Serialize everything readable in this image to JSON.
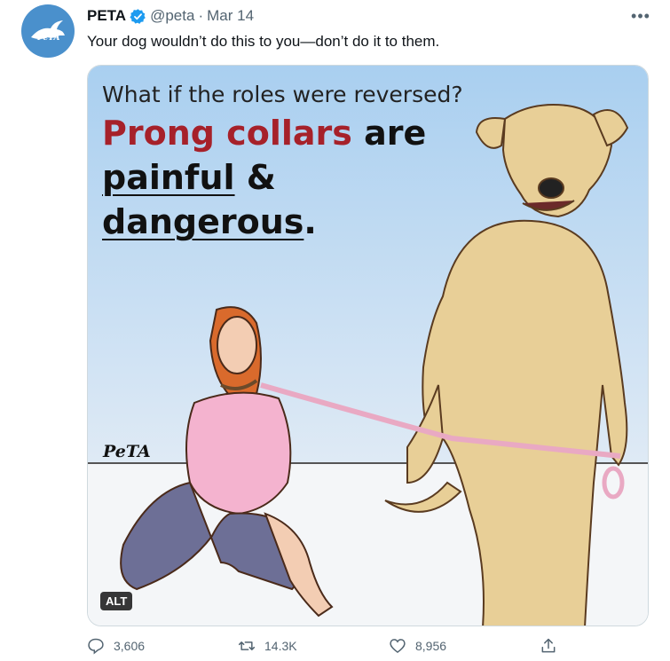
{
  "tweet": {
    "author_name": "PETA",
    "handle": "@peta",
    "separator": "·",
    "date": "Mar 14",
    "text": "Your dog wouldn’t do this to you—don’t do it to them.",
    "avatar_text": "PeTA"
  },
  "media": {
    "headline_line1": "What if the roles were reversed?",
    "headline_red": "Prong collars",
    "headline_are": " are",
    "headline_painful": "painful",
    "headline_amp": " &",
    "headline_dangerous": "dangerous",
    "headline_period": ".",
    "logo_text": "PeTA",
    "alt_label": "ALT"
  },
  "actions": {
    "replies": "3,606",
    "retweets": "14.3K",
    "likes": "8,956"
  },
  "colors": {
    "accent_blue": "#1d9bf0",
    "headline_red": "#a6212a",
    "muted": "#536471"
  }
}
